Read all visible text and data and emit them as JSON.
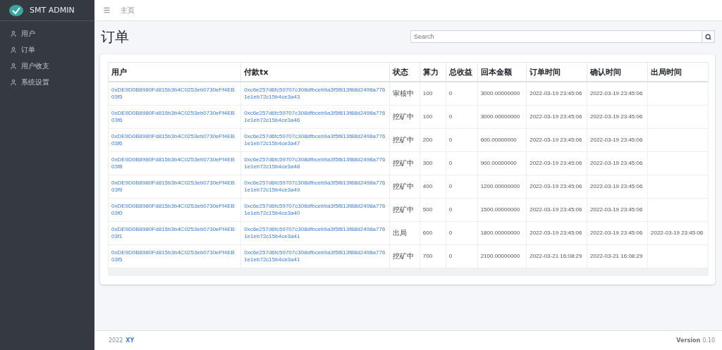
{
  "brand": {
    "name": "SMT ADMIN"
  },
  "sidebar": {
    "items": [
      {
        "label": "用户"
      },
      {
        "label": "订单"
      },
      {
        "label": "用户收支"
      },
      {
        "label": "系统设置"
      }
    ]
  },
  "topbar": {
    "breadcrumb": "主页"
  },
  "page": {
    "title": "订单",
    "search": {
      "placeholder": "Search"
    }
  },
  "table": {
    "columns": [
      "用户",
      "付款tx",
      "状态",
      "算力",
      "总收益",
      "回本金额",
      "订单时间",
      "确认时间",
      "出局时间"
    ],
    "rows": [
      [
        "0xDE9D0B8980Fd815b3b4C0253eb0730eFf4EB03f5",
        "0xc6e257d6fc59707c308dfbceb9a3f5f813f88d2498a7761e1eb72c15b4ce3a43",
        "审核中",
        "100",
        "0",
        "3000.00000000",
        "2022-03-19 23:45:06",
        "2022-03-19 23:45:06",
        ""
      ],
      [
        "0xDE9D0B8980Fd815b3b4C0253eb0730eFf4EB03f6",
        "0xc6e257d6fc59707c308dfbceb9a3f5f813f88d2498a7761e1eb72c15b4ce3a46",
        "挖矿中",
        "100",
        "0",
        "3000.00000000",
        "2022-03-19 23:45:06",
        "2022-03-19 23:45:06",
        ""
      ],
      [
        "0xDE9D0B8980Fd815b3b4C0253eb0730eFf4EB03f6",
        "0xc6e257d6fc59707c308dfbceb9a3f5f813f88d2498a7761e1eb72c15b4ce3a47",
        "挖矿中",
        "200",
        "0",
        "600.00000000",
        "2022-03-19 23:45:06",
        "2022-03-19 23:45:06",
        ""
      ],
      [
        "0xDE9D0B8980Fd815b3b4C0253eb0730eFf4EB03f8",
        "0xc6e257d6fc59707c308dfbceb9a3f5f813f88d2498a7761e1eb72c15b4ce3a48",
        "挖矿中",
        "300",
        "0",
        "900.00000000",
        "2022-03-19 23:45:06",
        "2022-03-19 23:45:06",
        ""
      ],
      [
        "0xDE9D0B8980Fd815b3b4C0253eb0730eFf4EB03f9",
        "0xc6e257d6fc59707c308dfbceb9a3f5f813f88d2498a7761e1eb72c15b4ce3a49",
        "挖矿中",
        "400",
        "0",
        "1200.00000000",
        "2022-03-19 23:45:06",
        "2022-03-19 23:45:06",
        ""
      ],
      [
        "0xDE9D0B8980Fd815b3b4C0253eb0730eFf4EB03f0",
        "0xc6e257d6fc59707c308dfbceb9a3f5f813f88d2498a7761e1eb72c15b4ce3a40",
        "挖矿中",
        "500",
        "0",
        "1500.00000000",
        "2022-03-19 23:45:06",
        "2022-03-19 23:45:06",
        ""
      ],
      [
        "0xDE9D0B8980Fd815b3b4C0253eb0730eFf4EB03f1",
        "0xc6e257d6fc59707c308dfbceb9a3f5f813f88d2498a7761e1eb72c15b4ce3a41",
        "出局",
        "600",
        "0",
        "1800.00000000",
        "2022-03-19 23:45:06",
        "2022-03-19 23:45:06",
        "2022-03-19 23:45:06"
      ],
      [
        "0xDE9D0B8980Fd815b3b4C0253eb0730eFf4EB03f5",
        "0xc6e257d6fc59707c308dfbceb9a3f5f813f88d2498a7761e1eb72c15b4ce3a41",
        "挖矿中",
        "700",
        "0",
        "2100.00000000",
        "2022-03-21 16:08:29",
        "2022-03-21 16:08:29",
        ""
      ]
    ]
  },
  "footer": {
    "copyright": "2022",
    "link": "XY",
    "version_label": "Version",
    "version": "0.10"
  }
}
